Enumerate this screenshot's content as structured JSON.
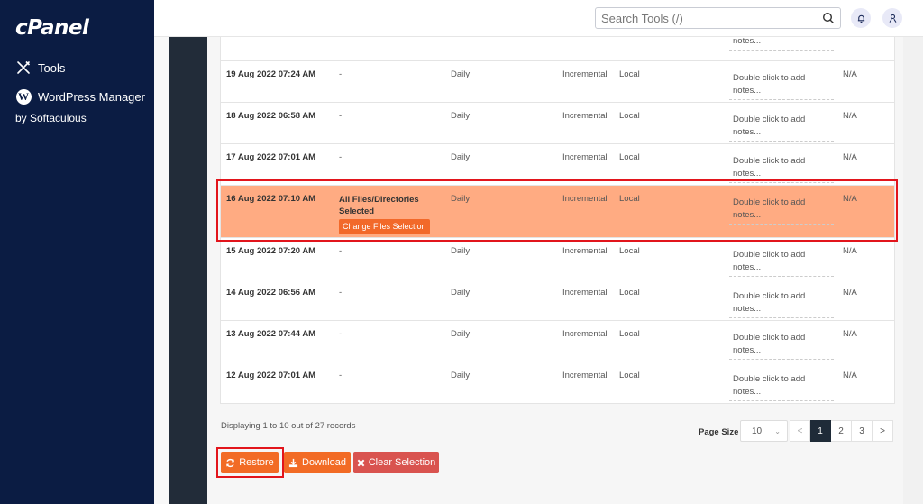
{
  "sidebar": {
    "logo": "cPanel",
    "items": [
      {
        "label": "Tools",
        "icon": "tools-icon"
      },
      {
        "label": "WordPress Manager",
        "sublabel": "by Softaculous",
        "icon": "wordpress-icon"
      }
    ]
  },
  "header": {
    "search_placeholder": "Search Tools (/)",
    "bell_icon": "bell-icon",
    "user_icon": "user-icon"
  },
  "table": {
    "partial_row": {
      "notes": "notes..."
    },
    "rows": [
      {
        "date": "19 Aug 2022 07:24 AM",
        "files": "-",
        "schedule": "Daily",
        "type": "Incremental",
        "location": "Local",
        "notes": "Double click to add notes...",
        "extra": "N/A",
        "selected": false
      },
      {
        "date": "18 Aug 2022 06:58 AM",
        "files": "-",
        "schedule": "Daily",
        "type": "Incremental",
        "location": "Local",
        "notes": "Double click to add notes...",
        "extra": "N/A",
        "selected": false
      },
      {
        "date": "17 Aug 2022 07:01 AM",
        "files": "-",
        "schedule": "Daily",
        "type": "Incremental",
        "location": "Local",
        "notes": "Double click to add notes...",
        "extra": "N/A",
        "selected": false
      },
      {
        "date": "16 Aug 2022 07:10 AM",
        "files": "All Files/Directories Selected",
        "change_label": "Change Files Selection",
        "schedule": "Daily",
        "type": "Incremental",
        "location": "Local",
        "notes": "Double click to add notes...",
        "extra": "N/A",
        "selected": true
      },
      {
        "date": "15 Aug 2022 07:20 AM",
        "files": "-",
        "schedule": "Daily",
        "type": "Incremental",
        "location": "Local",
        "notes": "Double click to add notes...",
        "extra": "N/A",
        "selected": false
      },
      {
        "date": "14 Aug 2022 06:56 AM",
        "files": "-",
        "schedule": "Daily",
        "type": "Incremental",
        "location": "Local",
        "notes": "Double click to add notes...",
        "extra": "N/A",
        "selected": false
      },
      {
        "date": "13 Aug 2022 07:44 AM",
        "files": "-",
        "schedule": "Daily",
        "type": "Incremental",
        "location": "Local",
        "notes": "Double click to add notes...",
        "extra": "N/A",
        "selected": false
      },
      {
        "date": "12 Aug 2022 07:01 AM",
        "files": "-",
        "schedule": "Daily",
        "type": "Incremental",
        "location": "Local",
        "notes": "Double click to add notes...",
        "extra": "N/A",
        "selected": false
      }
    ]
  },
  "footer": {
    "displaying": "Displaying 1 to 10 out of 27 records",
    "page_size_label": "Page Size",
    "page_size_value": "10",
    "pager": {
      "prev": "<",
      "pages": [
        "1",
        "2",
        "3"
      ],
      "active": "1",
      "next": ">"
    }
  },
  "actions": {
    "restore": "Restore",
    "download": "Download",
    "clear": "Clear Selection"
  },
  "colors": {
    "sidebar": "#0b1c43",
    "accent": "#f26b25",
    "selected_row": "#ffab82",
    "danger": "#d9534f",
    "highlight": "#e2151c"
  }
}
